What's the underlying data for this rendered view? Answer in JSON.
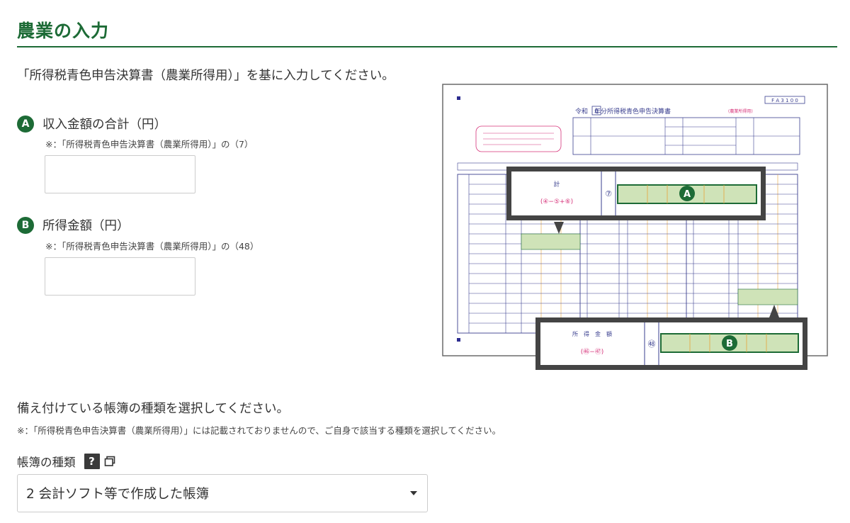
{
  "header": {
    "title": "農業の入力"
  },
  "intro": "「所得税青色申告決算書（農業所得用）」を基に入力してください。",
  "fields": [
    {
      "badge": "A",
      "label": "収入金額の合計（円）",
      "note": "※：「所得税青色申告決算書（農業所得用）」の（7）",
      "value": ""
    },
    {
      "badge": "B",
      "label": "所得金額（円）",
      "note": "※：「所得税青色申告決算書（農業所得用）」の（48）",
      "value": ""
    }
  ],
  "form_image": {
    "header_text": "令和　年分所得税青色申告決算書",
    "header_sub": "(農業所得用)",
    "form_code": "F A 3 1 0 0",
    "form_number": "0",
    "callout_a": {
      "row_label": "計",
      "formula": "(④−⑤+⑥)",
      "circle": "⑦",
      "badge": "A"
    },
    "callout_b": {
      "row_label": "所　得　金　額",
      "formula": "(㊻−㊼)",
      "circle": "㊽",
      "badge": "B"
    },
    "colors": {
      "line": "#3a3f8f",
      "pink": "#d6337a",
      "orange": "#e8a33c",
      "highlight": "#cfe3b8",
      "highlight_border": "#1d6b36",
      "frame": "#444444"
    }
  },
  "ledger": {
    "question": "備え付けている帳簿の種類を選択してください。",
    "note": "※：「所得税青色申告決算書（農業所得用）」には記載されておりませんので、ご自身で該当する種類を選択してください。",
    "label": "帳簿の種類",
    "help_icon": "?",
    "selected": "2 会計ソフト等で作成した帳簿"
  }
}
